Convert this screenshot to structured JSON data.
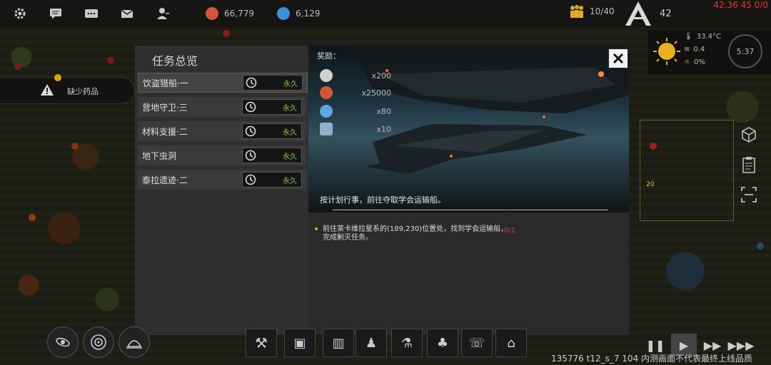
{
  "top_bar": {
    "icons": [
      "gear-icon",
      "chat-icon",
      "message-icon",
      "mail-icon",
      "friend-icon"
    ],
    "resource_1": {
      "value": "66,779",
      "color": "#d1563a"
    },
    "resource_2": {
      "value": "6,129",
      "color": "#3d8fd6"
    },
    "population": "10/40",
    "level": "42",
    "debug": "42.36 45 0/0"
  },
  "weather": {
    "temperature": "33.4°C",
    "wind": "0.4",
    "light": "0%",
    "timer": "5:37"
  },
  "alert": {
    "text": "缺少药品"
  },
  "mission_panel": {
    "title": "任务总览",
    "missions": [
      {
        "name": "饮盗猎船·一",
        "duration": "永久",
        "selected": true
      },
      {
        "name": "营地守卫·三",
        "duration": "永久",
        "selected": false
      },
      {
        "name": "材料支援·二",
        "duration": "永久",
        "selected": false
      },
      {
        "name": "地下虫洞",
        "duration": "永久",
        "selected": false
      },
      {
        "name": "泰拉遗迹·二",
        "duration": "永久",
        "selected": false
      }
    ],
    "detail": {
      "reward_title": "奖励：",
      "rewards": [
        {
          "icon": "helmet-icon",
          "value": "x200",
          "color": "#cfcfcf"
        },
        {
          "icon": "credit-icon",
          "value": "x25000",
          "color": "#d1563a"
        },
        {
          "icon": "crystal-icon",
          "value": "x80",
          "color": "#5aa8e0"
        },
        {
          "icon": "module-icon",
          "value": "x10",
          "color": "#8fb0c8"
        }
      ],
      "description": "按计划行事，前往夺取学会运输船。",
      "objective": "前往莱卡维拉星系的(189,230)位置处，找到学会运输船，完成剿灭任务。",
      "objective_progress": "0/1",
      "accent": "#e5b21c",
      "progress_color": "#d9352b"
    }
  },
  "bottom": {
    "build_info": "135776 t12_s_7 104 内测画面不代表最终上线品质"
  }
}
